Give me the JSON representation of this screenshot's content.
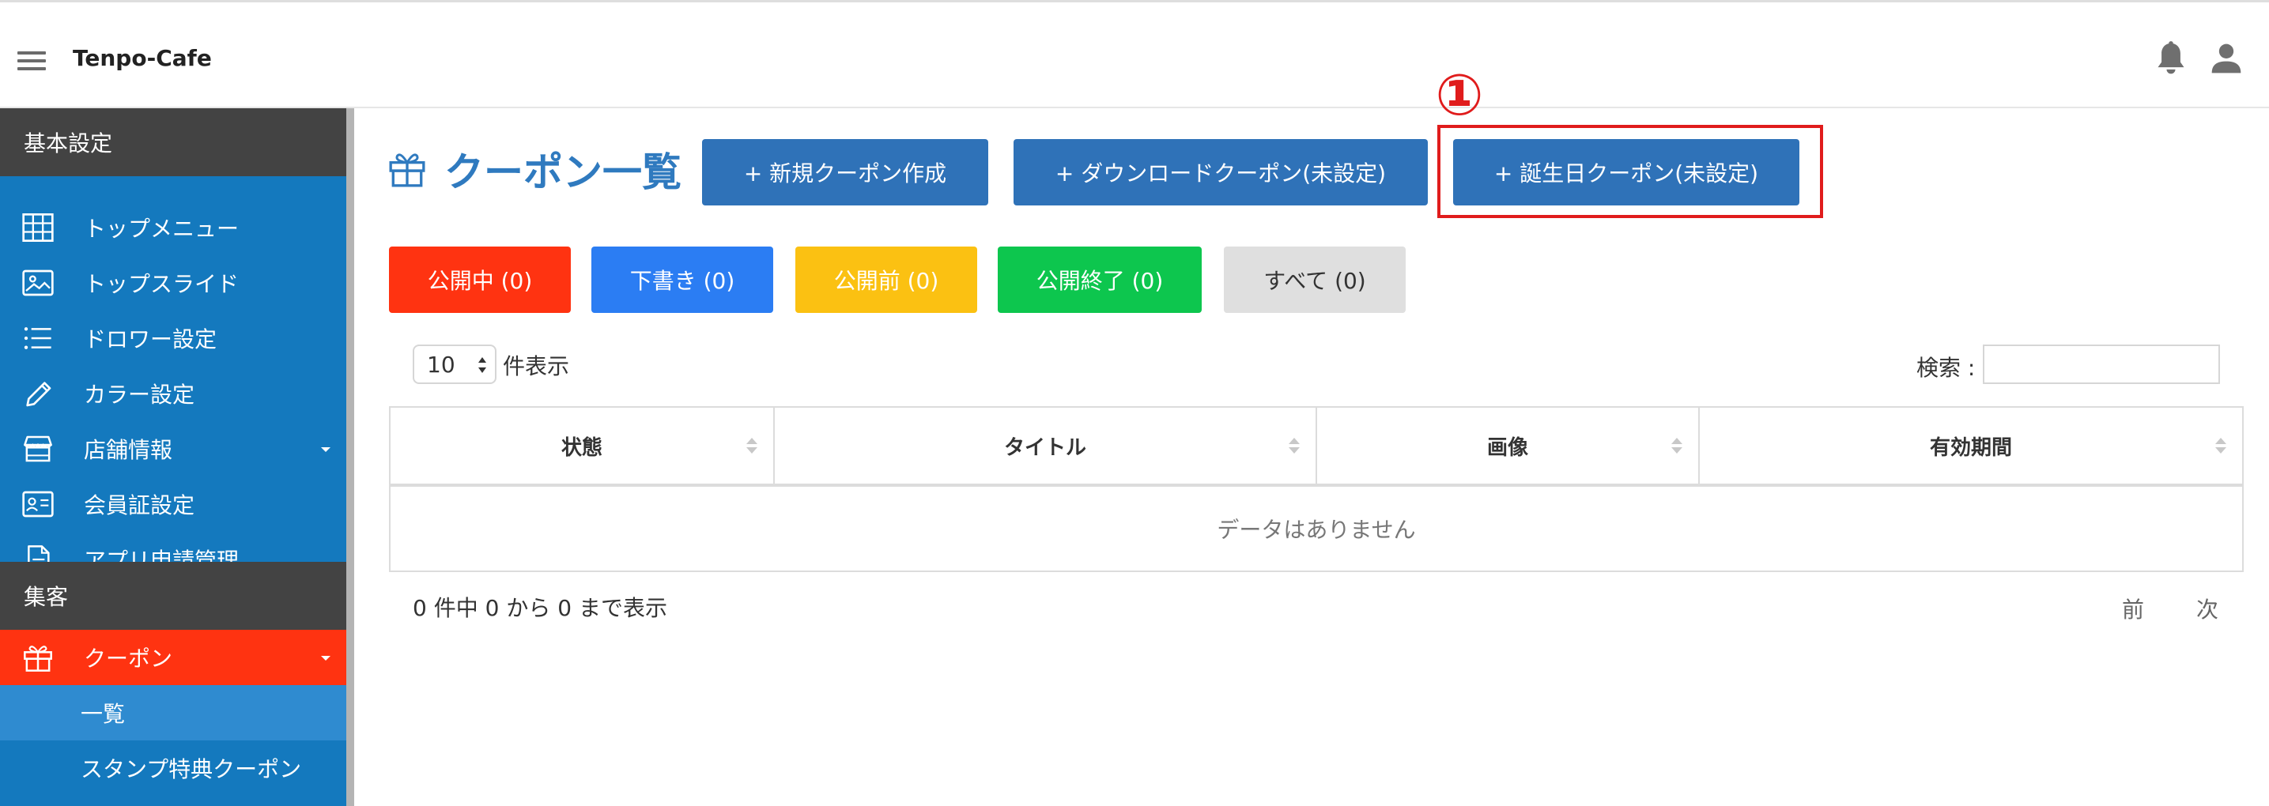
{
  "header": {
    "brand": "Tenpo-Cafe"
  },
  "sidebar": {
    "section_basic": "基本設定",
    "basic_items": [
      {
        "label": "トップメニュー",
        "icon": "grid-icon"
      },
      {
        "label": "トップスライド",
        "icon": "image-icon"
      },
      {
        "label": "ドロワー設定",
        "icon": "list-icon"
      },
      {
        "label": "カラー設定",
        "icon": "pencil-icon"
      },
      {
        "label": "店舗情報",
        "icon": "store-icon",
        "has_caret": true
      },
      {
        "label": "会員証設定",
        "icon": "id-card-icon"
      },
      {
        "label": "アプリ申請管理",
        "icon": "document-icon"
      }
    ],
    "section_attract": "集客",
    "coupon_item": {
      "label": "クーポン",
      "icon": "gift-icon",
      "has_caret": true
    },
    "sub_items": [
      "一覧",
      "スタンプ特典クーポン"
    ]
  },
  "main": {
    "page_title": "クーポン一覧",
    "buttons": {
      "new_coupon": "+ 新規クーポン作成",
      "download_coupon": "+ ダウンロードクーポン(未設定)",
      "birthday_coupon": "+ 誕生日クーポン(未設定)"
    },
    "annotation_marker": "①",
    "filters": [
      {
        "label": "公開中 (0)",
        "bg": "#ff3311",
        "fg": "#ffffff"
      },
      {
        "label": "下書き (0)",
        "bg": "#2b7df3",
        "fg": "#ffffff"
      },
      {
        "label": "公開前 (0)",
        "bg": "#fbc112",
        "fg": "#ffffff"
      },
      {
        "label": "公開終了 (0)",
        "bg": "#0dc64e",
        "fg": "#ffffff"
      },
      {
        "label": "すべて (0)",
        "bg": "#dfdfdf",
        "fg": "#333333"
      }
    ],
    "length": {
      "value": "10",
      "label": "件表示"
    },
    "search": {
      "label": "検索 :",
      "value": ""
    },
    "table": {
      "columns": [
        "状態",
        "タイトル",
        "画像",
        "有効期間"
      ],
      "empty_message": "データはありません"
    },
    "info": "0 件中 0 から 0 まで表示",
    "pagination": {
      "prev": "前",
      "next": "次"
    }
  },
  "colors": {
    "sidebar_bg": "#1479be",
    "sidebar_section_bg": "#434343",
    "active_item_bg": "#ff3311",
    "primary_button": "#2f72b8",
    "title_color": "#2f7abf",
    "highlight_border": "#e01c1c"
  }
}
